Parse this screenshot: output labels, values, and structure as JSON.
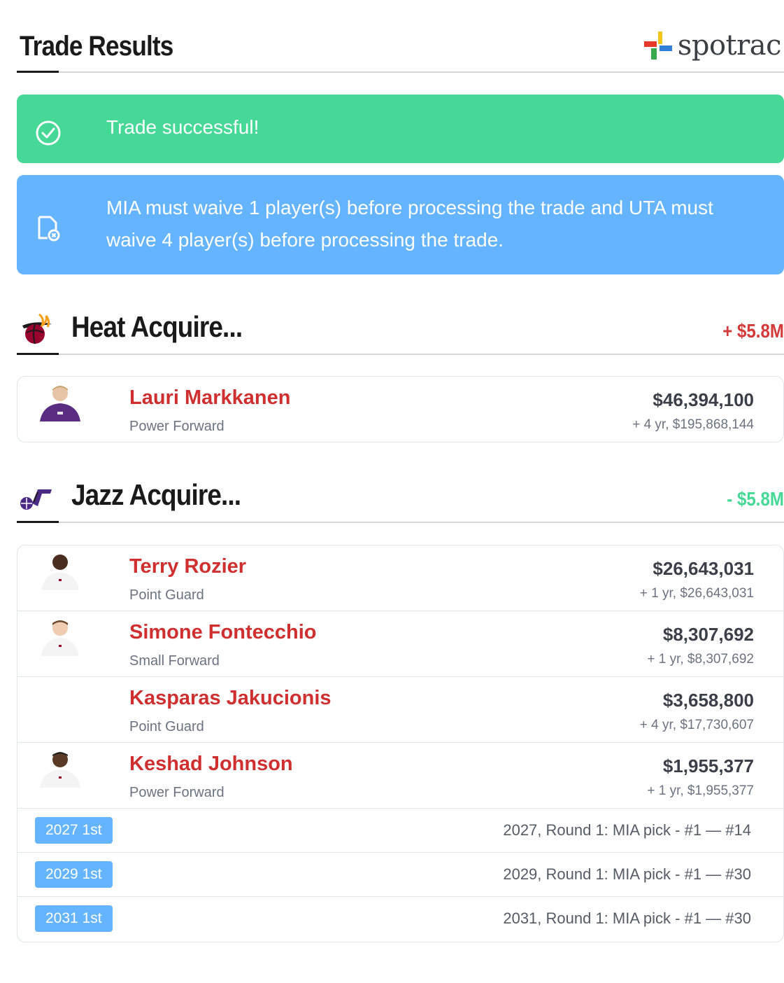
{
  "header": {
    "title": "Trade Results",
    "logo_text": "spotrac"
  },
  "alerts": {
    "success": {
      "icon": "check-circle-icon",
      "message": "Trade successful!",
      "color": "#45d896"
    },
    "info": {
      "icon": "document-x-icon",
      "message": "MIA must waive 1 player(s) before processing the trade and UTA must waive 4 player(s) before processing the trade.",
      "color": "#65b4ff"
    }
  },
  "heat": {
    "title": "Heat Acquire...",
    "delta": "+ $5.8M",
    "logo_icon": "heat-logo-icon",
    "players": [
      {
        "name": "Lauri Markkanen",
        "position": "Power Forward",
        "salary": "$46,394,100",
        "future": "+ 4 yr, $195,868,144"
      }
    ]
  },
  "jazz": {
    "title": "Jazz Acquire...",
    "delta": "- $5.8M",
    "logo_icon": "jazz-logo-icon",
    "players": [
      {
        "name": "Terry Rozier",
        "position": "Point Guard",
        "salary": "$26,643,031",
        "future": "+ 1 yr, $26,643,031"
      },
      {
        "name": "Simone Fontecchio",
        "position": "Small Forward",
        "salary": "$8,307,692",
        "future": "+ 1 yr, $8,307,692"
      },
      {
        "name": "Kasparas Jakucionis",
        "position": "Point Guard",
        "salary": "$3,658,800",
        "future": "+ 4 yr, $17,730,607"
      },
      {
        "name": "Keshad Johnson",
        "position": "Power Forward",
        "salary": "$1,955,377",
        "future": "+ 1 yr, $1,955,377"
      }
    ],
    "picks": [
      {
        "badge": "2027 1st",
        "description": "2027, Round 1: MIA pick - #1 — #14"
      },
      {
        "badge": "2029 1st",
        "description": "2029, Round 1: MIA pick - #1 — #30"
      },
      {
        "badge": "2031 1st",
        "description": "2031, Round 1: MIA pick - #1 — #30"
      }
    ]
  },
  "colors": {
    "player_name": "#d02f2f",
    "positive_delta": "#d43a3a",
    "negative_delta": "#45d896",
    "pick_badge": "#65b4ff"
  }
}
